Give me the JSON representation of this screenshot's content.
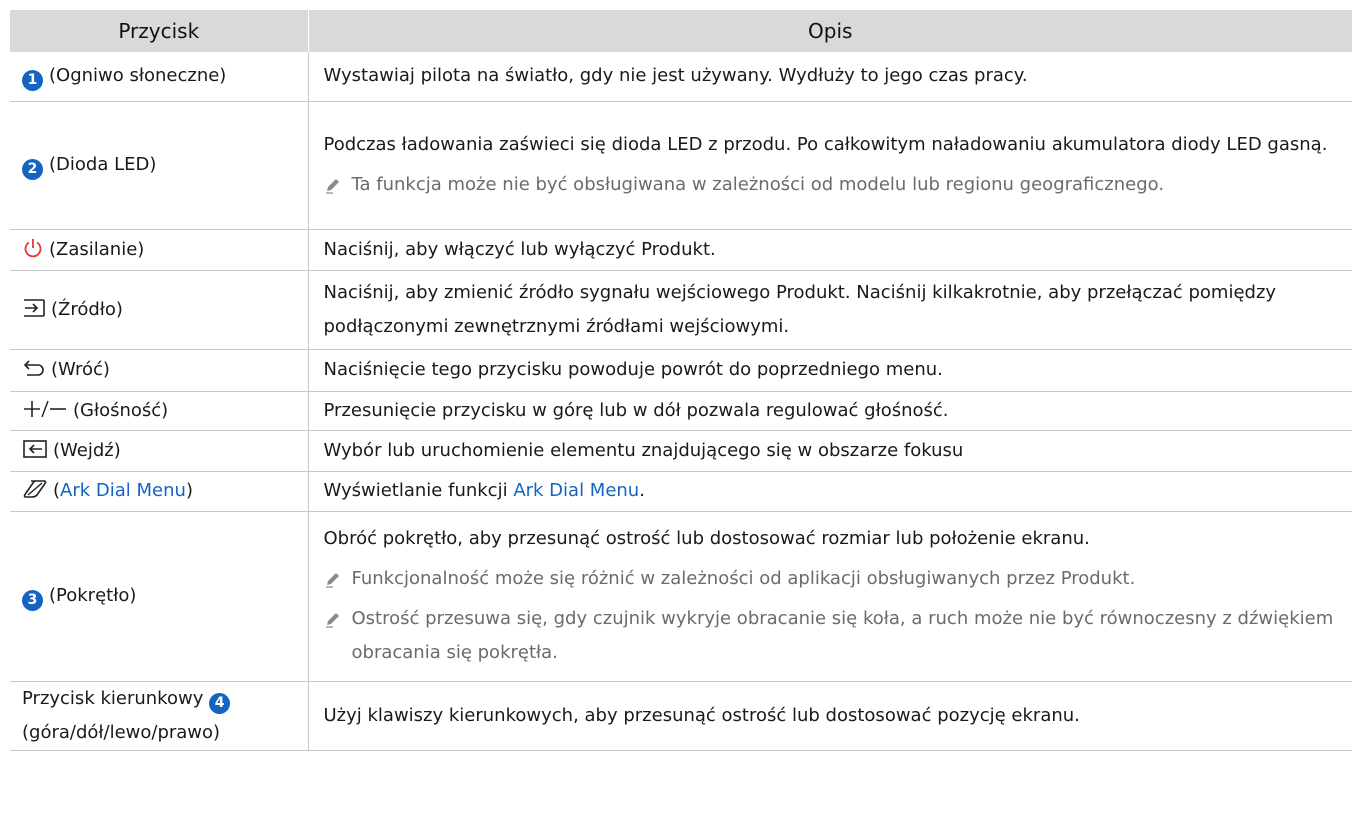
{
  "table": {
    "headers": [
      "Przycisk",
      "Opis"
    ],
    "rows": {
      "solar": {
        "number": "1",
        "button": "(Ogniwo słoneczne)",
        "desc": "Wystawiaj pilota na światło, gdy nie jest używany. Wydłuży to jego czas pracy."
      },
      "led": {
        "number": "2",
        "button": "(Dioda LED)",
        "desc": "Podczas ładowania zaświeci się dioda LED z przodu. Po całkowitym naładowaniu akumulatora diody LED gasną.",
        "note": "Ta funkcja może nie być obsługiwana w zależności od modelu lub regionu geograficznego."
      },
      "power": {
        "button": "(Zasilanie)",
        "desc": "Naciśnij, aby włączyć lub wyłączyć Produkt.",
        "icon": "power-icon"
      },
      "source": {
        "button": "(Źródło)",
        "desc": "Naciśnij, aby zmienić źródło sygnału wejściowego Produkt. Naciśnij kilkakrotnie, aby przełączać pomiędzy podłączonymi zewnętrznymi źródłami wejściowymi.",
        "icon": "source-icon"
      },
      "return": {
        "button": "(Wróć)",
        "desc": "Naciśnięcie tego przycisku powoduje powrót do poprzedniego menu.",
        "icon": "return-arrow-icon"
      },
      "volume": {
        "button": "(Głośność)",
        "desc": "Przesunięcie przycisku w górę lub w dół pozwala regulować głośność.",
        "icon": "plus-minus-icon"
      },
      "enter": {
        "button": "(Wejdź)",
        "desc": "Wybór lub uruchomienie elementu znajdującego się w obszarze fokusu",
        "icon": "enter-icon"
      },
      "ark": {
        "button_open": "(",
        "button_link": "Ark Dial Menu",
        "button_close": ")",
        "desc_prefix": "Wyświetlanie funkcji ",
        "desc_link": "Ark Dial Menu",
        "desc_suffix": ".",
        "icon": "ark-dial-icon"
      },
      "dial": {
        "number": "3",
        "button": "(Pokrętło)",
        "desc": "Obróć pokrętło, aby przesunąć ostrość lub dostosować rozmiar lub położenie ekranu.",
        "note1": "Funkcjonalność może się różnić w zależności od aplikacji obsługiwanych przez Produkt.",
        "note2": "Ostrość przesuwa się, gdy czujnik wykryje obracanie się koła, a ruch może nie być równoczesny z dźwiękiem obracania się pokrętła."
      },
      "direction": {
        "number": "4",
        "button_line1": "Przycisk kierunkowy",
        "button_line2": "(góra/dół/lewo/prawo)",
        "desc": "Użyj klawiszy kierunkowych, aby przesunąć ostrość lub dostosować pozycję ekranu."
      }
    }
  },
  "colors": {
    "accent": "#1565c0",
    "header_bg": "#d9d9d9",
    "note_text": "#6b6b6b"
  }
}
